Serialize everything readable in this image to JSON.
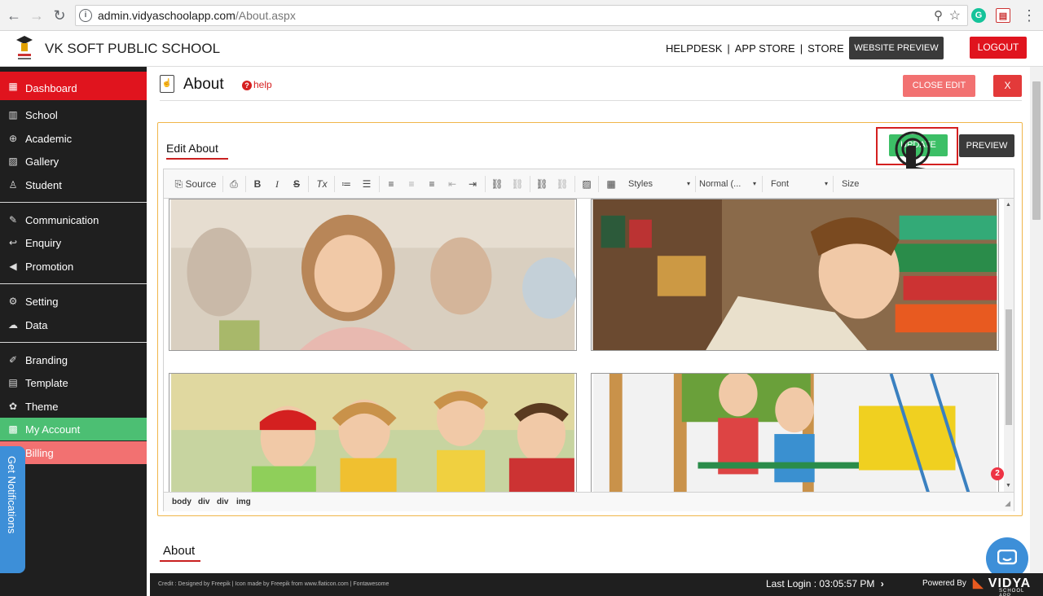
{
  "browser": {
    "url_host": "admin.vidyaschoolapp.com",
    "url_path": "/About.aspx"
  },
  "header": {
    "school_name": "VK SOFT PUBLIC SCHOOL",
    "links": [
      "HELPDESK",
      "APP STORE",
      "STORE"
    ],
    "link_separator": "|",
    "website_preview": "WEBSITE PREVIEW",
    "logout": "LOGOUT"
  },
  "sidebar": {
    "items": [
      {
        "label": "Dashboard",
        "icon": "dashboard-icon"
      },
      {
        "label": "School",
        "icon": "building-icon"
      },
      {
        "label": "Academic",
        "icon": "globe-icon"
      },
      {
        "label": "Gallery",
        "icon": "image-icon"
      },
      {
        "label": "Student",
        "icon": "student-icon"
      },
      {
        "label": "Communication",
        "icon": "tools-icon"
      },
      {
        "label": "Enquiry",
        "icon": "reply-icon"
      },
      {
        "label": "Promotion",
        "icon": "megaphone-icon"
      },
      {
        "label": "Setting",
        "icon": "gear-icon"
      },
      {
        "label": "Data",
        "icon": "cloud-icon"
      },
      {
        "label": "Branding",
        "icon": "brush-icon"
      },
      {
        "label": "Template",
        "icon": "template-icon"
      },
      {
        "label": "Theme",
        "icon": "palette-icon"
      },
      {
        "label": "My Account",
        "icon": "account-icon"
      },
      {
        "label": "Billing",
        "icon": "billing-icon"
      }
    ],
    "notifications_tab": "Get Notifications"
  },
  "page": {
    "title": "About",
    "help": "help",
    "close_edit": "CLOSE EDIT",
    "close_x": "X"
  },
  "editor_panel": {
    "title": "Edit About",
    "update": "UPDATE",
    "preview": "PREVIEW",
    "toolbar": {
      "source": "Source",
      "styles": "Styles",
      "format": "Normal (...",
      "font": "Font",
      "size": "Size"
    },
    "path": [
      "body",
      "div",
      "div",
      "img"
    ]
  },
  "about_section": {
    "heading": "About"
  },
  "footer": {
    "credit": "Credit : Designed by Freepik | Icon made by Freepik from www.flaticon.com | Fontawesome",
    "last_login": "Last Login : 03:05:57 PM",
    "powered_by": "Powered By",
    "brand": "VIDYA",
    "brand_sub": "SCHOOL APP"
  },
  "chat": {
    "badge": "2"
  },
  "colors": {
    "brand_red": "#e0141e",
    "sidebar_bg": "#1f1f1f",
    "update_green": "#3cbf66",
    "panel_border": "#f0b64a",
    "account_green": "#4cbf73",
    "billing_pink": "#f27171"
  }
}
